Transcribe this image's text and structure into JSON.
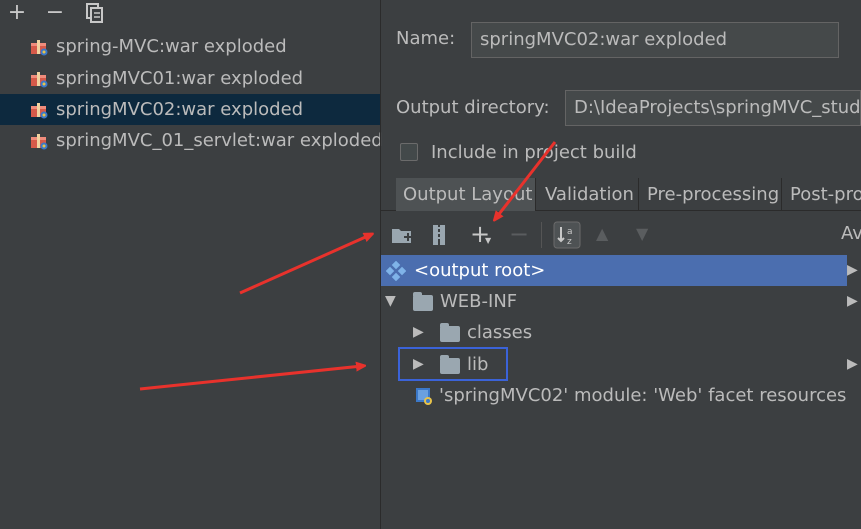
{
  "left_toolbar": {
    "add_icon": "plus-icon",
    "remove_icon": "minus-icon",
    "copy_icon": "copy-icon"
  },
  "artifacts": [
    {
      "label": "spring-MVC:war exploded",
      "selected": false
    },
    {
      "label": "springMVC01:war exploded",
      "selected": false
    },
    {
      "label": "springMVC02:war exploded",
      "selected": true
    },
    {
      "label": "springMVC_01_servlet:war exploded",
      "selected": false
    }
  ],
  "name_field": {
    "label": "Name:",
    "value": "springMVC02:war exploded"
  },
  "output_dir": {
    "label": "Output directory:",
    "value": "D:\\IdeaProjects\\springMVC_study"
  },
  "include_build": {
    "label": "Include in project build",
    "checked": false
  },
  "tabs": [
    "Output Layout",
    "Validation",
    "Pre-processing",
    "Post-pro"
  ],
  "layout_toolbar": {
    "available_label": "Av"
  },
  "tree": {
    "output_root": "<output root>",
    "web_inf": "WEB-INF",
    "classes": "classes",
    "lib": "lib",
    "facet": "'springMVC02' module: 'Web' facet resources"
  },
  "colors": {
    "selection": "#0d293e",
    "tree_selection": "#4b6eaf",
    "annotation_arrow": "#e8322c",
    "highlight_box": "#3b63d8"
  }
}
